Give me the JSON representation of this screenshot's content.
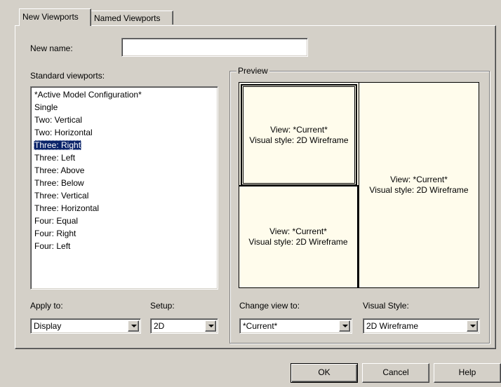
{
  "tabs": [
    {
      "label": "New Viewports",
      "active": true
    },
    {
      "label": "Named Viewports",
      "active": false
    }
  ],
  "new_name": {
    "label": "New name:",
    "value": ""
  },
  "standard_viewports": {
    "label": "Standard viewports:",
    "items": [
      "*Active Model Configuration*",
      "Single",
      "Two:  Vertical",
      "Two:  Horizontal",
      "Three: Right",
      "Three: Left",
      "Three: Above",
      "Three: Below",
      "Three: Vertical",
      "Three: Horizontal",
      "Four:  Equal",
      "Four:  Right",
      "Four:  Left"
    ],
    "selected_index": 4
  },
  "preview": {
    "label": "Preview",
    "viewports": [
      {
        "view": "View: *Current*",
        "style": "Visual style: 2D Wireframe"
      },
      {
        "view": "View: *Current*",
        "style": "Visual style: 2D Wireframe"
      },
      {
        "view": "View: *Current*",
        "style": "Visual style: 2D Wireframe"
      }
    ]
  },
  "apply_to": {
    "label": "Apply to:",
    "value": "Display"
  },
  "setup": {
    "label": "Setup:",
    "value": "2D"
  },
  "change_view": {
    "label": "Change view to:",
    "value": "*Current*"
  },
  "visual_style": {
    "label": "Visual Style:",
    "value": "2D Wireframe"
  },
  "buttons": {
    "ok": "OK",
    "cancel": "Cancel",
    "help": "Help"
  },
  "colors": {
    "preview_bg": "#fffcec",
    "dialog_bg": "#d4d0c8",
    "selection": "#0a246a"
  }
}
